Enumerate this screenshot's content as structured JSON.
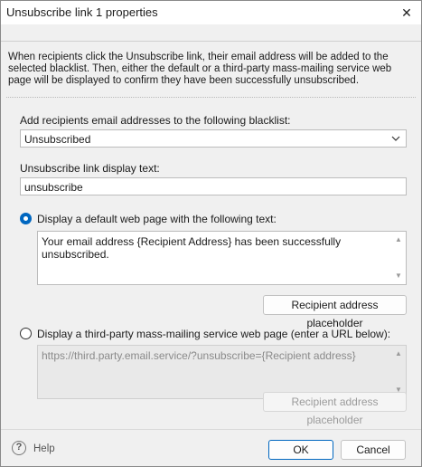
{
  "window": {
    "title": "Unsubscribe link 1 properties",
    "close_glyph": "✕"
  },
  "description": "When recipients click the Unsubscribe link, their email address will be added to the selected blacklist. Then, either the default or a third-party mass-mailing service web page will be displayed to confirm they have been successfully unsubscribed.",
  "blacklist": {
    "label": "Add recipients email addresses to the following blacklist:",
    "selected": "Unsubscribed",
    "chevron_icon": "chevron-down-icon"
  },
  "display_text": {
    "label": "Unsubscribe link display text:",
    "value": "unsubscribe"
  },
  "option_default": {
    "label": "Display a default web page with the following text:",
    "selected": true,
    "text": "Your email address {Recipient Address} has been successfully unsubscribed.",
    "placeholder_button": "Recipient address placeholder"
  },
  "option_third_party": {
    "label": "Display a third-party mass-mailing service web page (enter a URL below):",
    "selected": false,
    "url": "https://third.party.email.service/?unsubscribe={Recipient address}",
    "placeholder_button": "Recipient address placeholder"
  },
  "footer": {
    "help_label": "Help",
    "ok_label": "OK",
    "cancel_label": "Cancel"
  },
  "colors": {
    "accent": "#0067c0",
    "dialog_bg": "#f0f0f0"
  }
}
